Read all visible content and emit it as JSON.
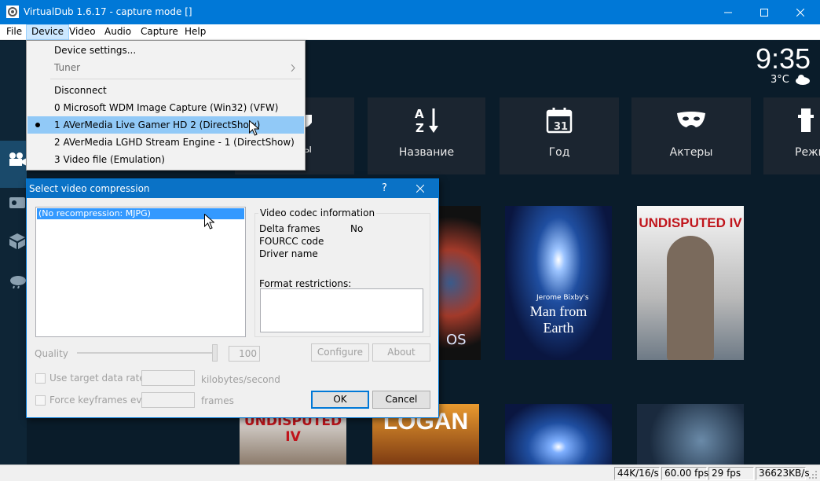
{
  "window": {
    "title": "VirtualDub 1.6.17 - capture mode []"
  },
  "menubar": [
    "File",
    "Device",
    "Video",
    "Audio",
    "Capture",
    "Help"
  ],
  "device_menu": {
    "items": [
      {
        "label": "Device settings...",
        "enabled": true
      },
      {
        "label": "Tuner",
        "enabled": false,
        "submenu": true
      },
      {
        "label": "Disconnect",
        "enabled": true
      },
      {
        "label": "0 Microsoft WDM Image Capture (Win32) (VFW)",
        "enabled": true
      },
      {
        "label": "1 AVerMedia Live Gamer HD 2 (DirectShow)",
        "enabled": true,
        "selected": true
      },
      {
        "label": "2 AVerMedia LGHD Stream Engine - 1 (DirectShow)",
        "enabled": true
      },
      {
        "label": "3 Video file (Emulation)",
        "enabled": true
      }
    ]
  },
  "background": {
    "clock": "9:35",
    "weather": "3°C",
    "tiles": [
      "Название",
      "Год",
      "Актеры",
      "Режи"
    ],
    "tile_icons": [
      "mask-icon",
      "sort-az-icon",
      "calendar-icon",
      "mask-icon",
      "film-icon"
    ],
    "calendar_day": "31",
    "partial_tile_text": "ы",
    "posters": {
      "row1_left_text": "OS",
      "man_from_earth": "Man from Earth",
      "man_from_earth_credit": "Jerome Bixby's",
      "undisputed_top": "UNDISPUTED IV",
      "undisputed_bottom": "UNDISPUTED IV",
      "logan": "LOGAN"
    }
  },
  "dialog": {
    "title": "Select video compression",
    "help": "?",
    "codec_list": [
      "(No recompression: MJPG)"
    ],
    "codec_info": {
      "group_label": "Video codec information",
      "delta_frames_label": "Delta frames",
      "delta_frames_value": "No",
      "fourcc_label": "FOURCC code",
      "driver_label": "Driver name",
      "format_label": "Format restrictions:"
    },
    "quality_label": "Quality",
    "quality_value": "100",
    "configure": "Configure",
    "about": "About",
    "target_rate_label": "Use target data rate of",
    "rate_unit": "kilobytes/second",
    "keyframes_label": "Force keyframes every",
    "frames_unit": "frames",
    "ok": "OK",
    "cancel": "Cancel"
  },
  "status": [
    "44K/16/s",
    "60.00 fps",
    "29 fps",
    "36623KB/s"
  ],
  "colors": {
    "titlebar": "#0078d7",
    "menu_highlight": "#91c9f7",
    "list_selection": "#3399ff",
    "kodi_bg": "#0a1c2a",
    "tile_bg": "#1b2530"
  }
}
